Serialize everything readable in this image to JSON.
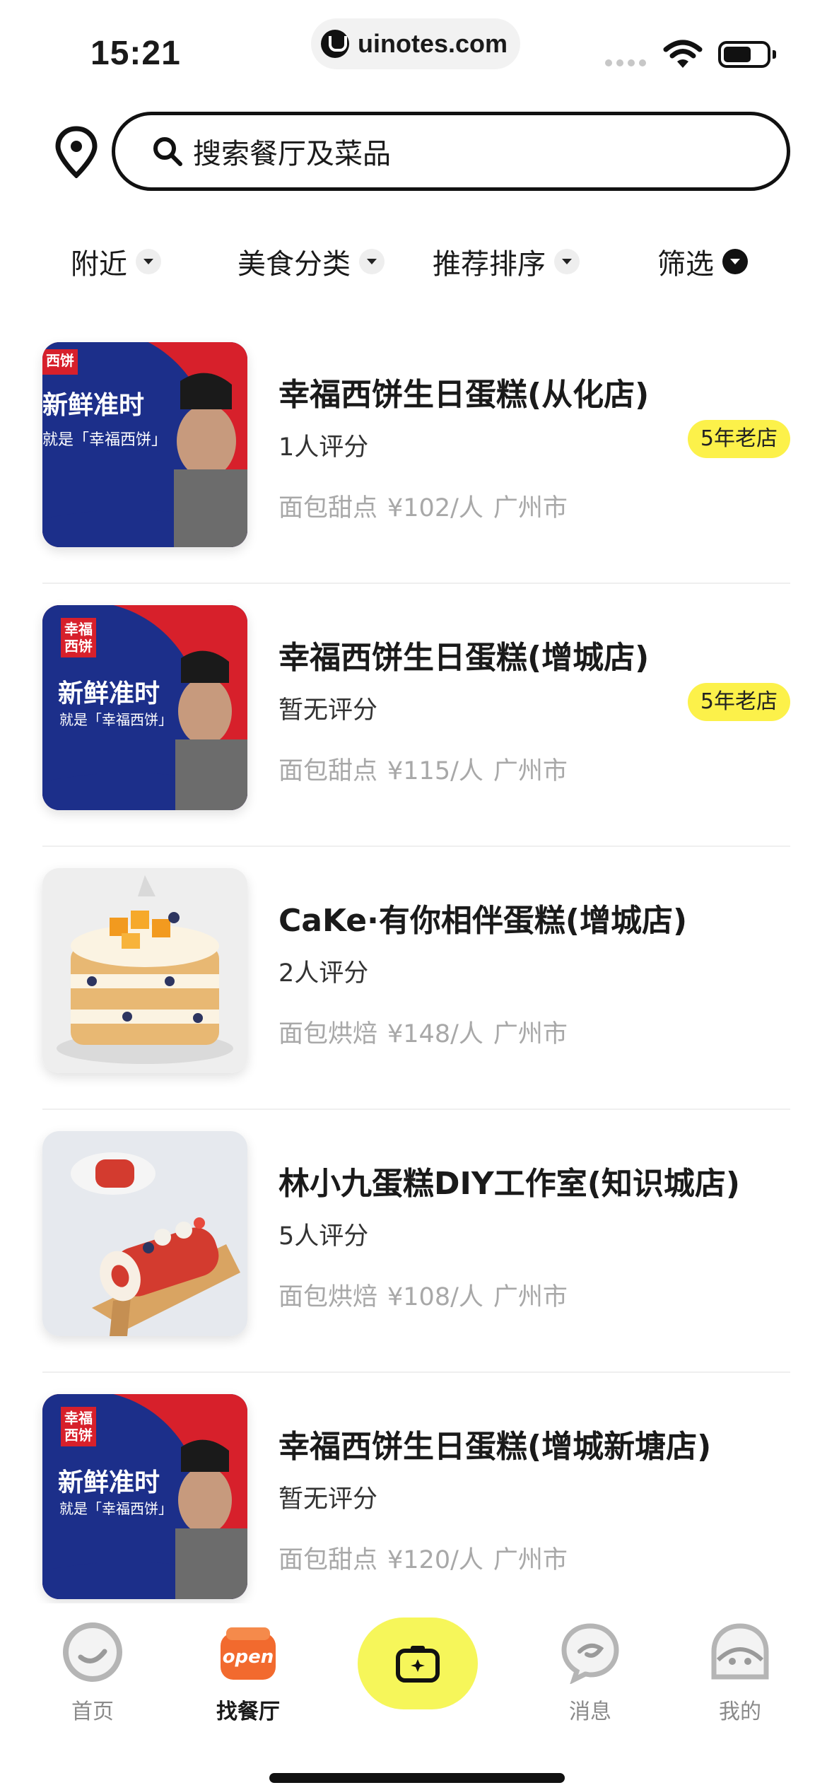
{
  "status_bar": {
    "time": "15:21",
    "url": "uinotes.com"
  },
  "search": {
    "placeholder": "搜索餐厅及菜品"
  },
  "filters": [
    {
      "label": "附近"
    },
    {
      "label": "美食分类"
    },
    {
      "label": "推荐排序"
    },
    {
      "label": "筛选"
    }
  ],
  "restaurants": [
    {
      "name": "幸福西饼生日蛋糕(从化店)",
      "rating": "1人评分",
      "badge": "5年老店",
      "category": "面包甜点",
      "price": "¥102/人",
      "city": "广州市",
      "image": {
        "kind": "poster",
        "logo_text": "西饼",
        "headline": "新鲜准时",
        "subline": "就是「幸福西饼」"
      }
    },
    {
      "name": "幸福西饼生日蛋糕(增城店)",
      "rating": "暂无评分",
      "badge": "5年老店",
      "category": "面包甜点",
      "price": "¥115/人",
      "city": "广州市",
      "image": {
        "kind": "poster",
        "logo_text": "幸福西饼",
        "headline": "新鲜准时",
        "subline": "就是「幸福西饼」"
      }
    },
    {
      "name": "CaKe·有你相伴蛋糕(增城店)",
      "rating": "2人评分",
      "badge": "",
      "category": "面包烘焙",
      "price": "¥148/人",
      "city": "广州市",
      "image": {
        "kind": "layer-cake"
      }
    },
    {
      "name": "林小九蛋糕DIY工作室(知识城店)",
      "rating": "5人评分",
      "badge": "",
      "category": "面包烘焙",
      "price": "¥108/人",
      "city": "广州市",
      "image": {
        "kind": "roll-cake"
      }
    },
    {
      "name": "幸福西饼生日蛋糕(增城新塘店)",
      "rating": "暂无评分",
      "badge": "",
      "category": "面包甜点",
      "price": "¥120/人",
      "city": "广州市",
      "image": {
        "kind": "poster",
        "logo_text": "幸福西饼",
        "headline": "新鲜准时",
        "subline": "就是「幸福西饼」"
      }
    }
  ],
  "tab_bar": {
    "tabs": [
      {
        "label": "首页",
        "icon": "home-smile-icon"
      },
      {
        "label": "找餐厅",
        "icon": "open-restaurant-icon",
        "active": true
      },
      {
        "label": "",
        "icon": "camera-icon"
      },
      {
        "label": "消息",
        "icon": "message-bubble-icon"
      },
      {
        "label": "我的",
        "icon": "profile-face-icon"
      }
    ]
  },
  "colors": {
    "accent_yellow": "#f6f65a",
    "badge_yellow": "#fcf14a",
    "poster_blue": "#1c2f8a",
    "poster_red": "#d7202b"
  }
}
